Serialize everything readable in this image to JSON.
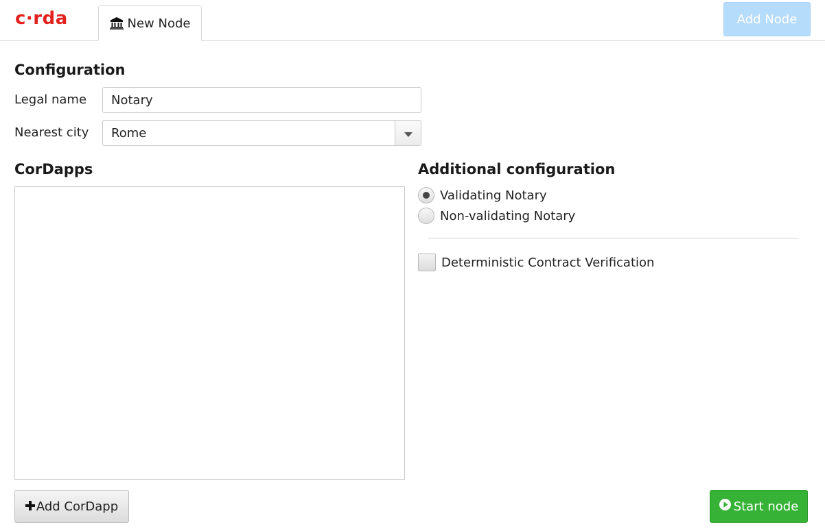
{
  "app": {
    "logo_text": "c·rda",
    "brand_color": "#e2211c"
  },
  "tabs": [
    {
      "label": "New Node",
      "icon": "bank-icon"
    }
  ],
  "toolbar": {
    "add_node_label": "Add Node"
  },
  "configuration": {
    "heading": "Configuration",
    "legal_name_label": "Legal name",
    "legal_name_value": "Notary",
    "nearest_city_label": "Nearest city",
    "nearest_city_value": "Rome"
  },
  "cordapps": {
    "heading": "CorDapps",
    "items": [],
    "add_label": "Add CorDapp",
    "add_icon": "plus-icon"
  },
  "additional": {
    "heading": "Additional configuration",
    "notary_options": [
      {
        "label": "Validating Notary",
        "selected": true
      },
      {
        "label": "Non-validating Notary",
        "selected": false
      }
    ],
    "deterministic_label": "Deterministic Contract Verification",
    "deterministic_checked": false
  },
  "actions": {
    "start_label": "Start node",
    "start_icon": "play-circle-icon",
    "start_color": "#36b336",
    "add_node_color": "#b6dcfc"
  }
}
